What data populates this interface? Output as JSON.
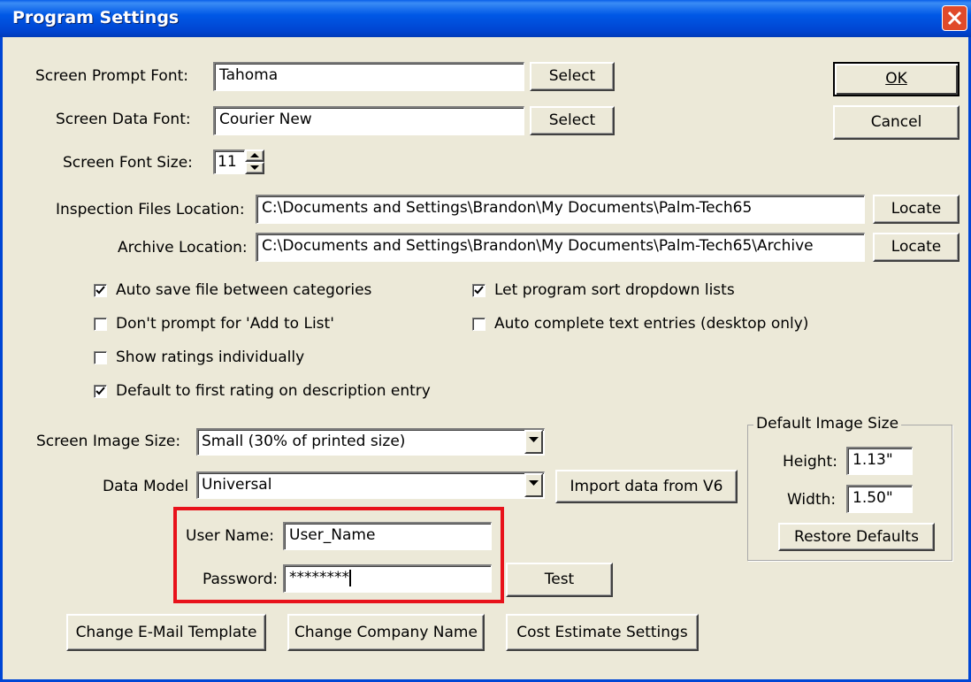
{
  "window": {
    "title": "Program Settings"
  },
  "fonts": {
    "prompt_label": "Screen Prompt Font:",
    "prompt_value": "Tahoma",
    "data_label": "Screen Data Font:",
    "data_value": "Courier New",
    "select_label": "Select",
    "size_label": "Screen Font Size:",
    "size_value": "11"
  },
  "buttons": {
    "ok": "OK",
    "cancel": "Cancel"
  },
  "locations": {
    "inspection_label": "Inspection Files Location:",
    "inspection_value": "C:\\Documents and Settings\\Brandon\\My Documents\\Palm-Tech65",
    "archive_label": "Archive Location:",
    "archive_value": "C:\\Documents and Settings\\Brandon\\My Documents\\Palm-Tech65\\Archive",
    "locate_label": "Locate"
  },
  "options": [
    {
      "label": "Auto save file between categories",
      "checked": true
    },
    {
      "label": "Don't prompt for 'Add to List'",
      "checked": false
    },
    {
      "label": "Show ratings individually",
      "checked": false
    },
    {
      "label": "Default to first rating on description entry",
      "checked": true
    },
    {
      "label": "Let program sort dropdown lists",
      "checked": true
    },
    {
      "label": "Auto complete text entries (desktop only)",
      "checked": false
    }
  ],
  "image": {
    "size_label": "Screen Image Size:",
    "size_value": "Small (30% of printed size)",
    "model_label": "Data Model",
    "model_value": "Universal",
    "import_label": "Import data from V6"
  },
  "default_image": {
    "group_label": "Default Image Size",
    "height_label": "Height:",
    "height_value": "1.13\"",
    "width_label": "Width:",
    "width_value": "1.50\"",
    "restore_label": "Restore Defaults"
  },
  "credentials": {
    "user_label": "User Name:",
    "user_value": "User_Name",
    "password_label": "Password:",
    "password_value": "********",
    "test_label": "Test"
  },
  "bottom": {
    "email_label": "Change E-Mail Template",
    "company_label": "Change Company Name",
    "cost_label": "Cost Estimate Settings"
  },
  "colors": {
    "title_bar": "#0054e3",
    "highlight": "#e8121b",
    "dialog_bg": "#ece9d8"
  }
}
